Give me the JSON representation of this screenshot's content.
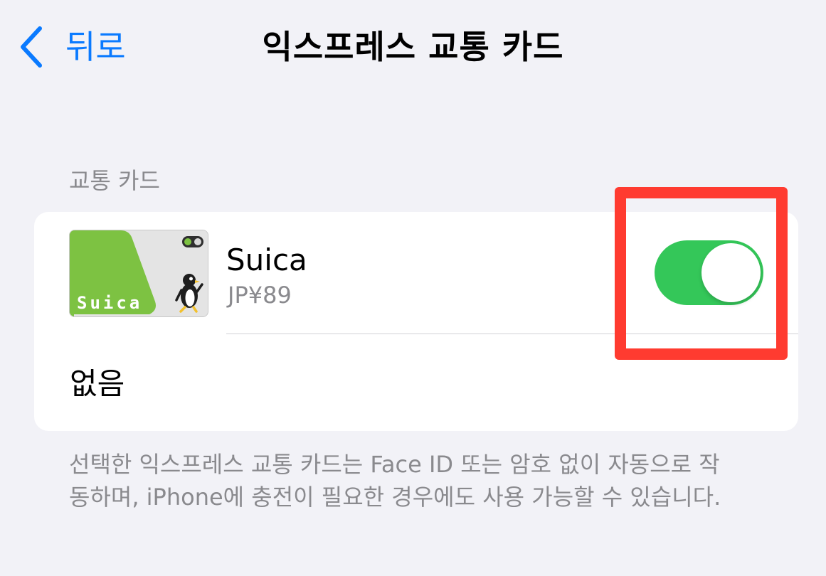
{
  "nav": {
    "back_label": "뒤로",
    "title": "익스프레스 교통 카드"
  },
  "section": {
    "header": "교통 카드"
  },
  "cards": [
    {
      "name": "Suica",
      "balance": "JP¥89",
      "toggle_on": true,
      "logo_text": "Suica"
    }
  ],
  "none_option": "없음",
  "footer": "선택한 익스프레스 교통 카드는 Face ID 또는 암호 없이 자동으로 작동하며, iPhone에 충전이 필요한 경우에도 사용 가능할 수 있습니다.",
  "icons": {
    "back": "chevron-left-icon",
    "card_logo": "suica-penguin-icon"
  },
  "colors": {
    "accent": "#0a7aff",
    "toggle_on": "#34c759",
    "highlight": "#ff3b30",
    "secondary_text": "#8a8a8e",
    "background": "#f2f2f7",
    "suica_green": "#7dc242"
  }
}
